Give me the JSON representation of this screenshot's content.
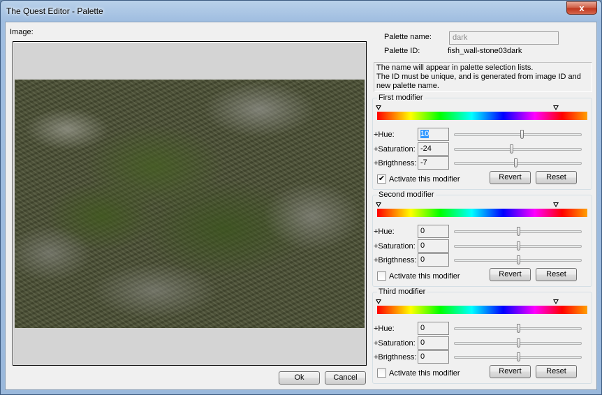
{
  "window": {
    "title": "The Quest Editor - Palette",
    "close_glyph": "x"
  },
  "image": {
    "label": "Image:"
  },
  "palette": {
    "name_label": "Palette name:",
    "name_value": "dark",
    "id_label": "Palette ID:",
    "id_value": "fish_wall-stone03dark",
    "hint_lines": [
      "The name will appear in palette selection lists.",
      "The ID must be unique, and is generated from image ID and",
      "new palette name."
    ]
  },
  "modifier_labels": {
    "hue": "+Hue:",
    "saturation": "+Saturation:",
    "brightness": "+Brigthness:",
    "activate": "Activate this modifier",
    "revert": "Revert",
    "reset": "Reset"
  },
  "modifiers": [
    {
      "title": "First modifier",
      "hue": "10",
      "saturation": "-24",
      "brightness": "-7",
      "active": true,
      "hue_level": 0.53,
      "sat_level": 0.45,
      "bri_level": 0.48,
      "check_glyph": "✔"
    },
    {
      "title": "Second modifier",
      "hue": "0",
      "saturation": "0",
      "brightness": "0",
      "active": false,
      "hue_level": 0.5,
      "sat_level": 0.5,
      "bri_level": 0.5,
      "check_glyph": ""
    },
    {
      "title": "Third modifier",
      "hue": "0",
      "saturation": "0",
      "brightness": "0",
      "active": false,
      "hue_level": 0.5,
      "sat_level": 0.5,
      "bri_level": 0.5,
      "check_glyph": ""
    }
  ],
  "buttons": {
    "ok": "Ok",
    "cancel": "Cancel"
  }
}
